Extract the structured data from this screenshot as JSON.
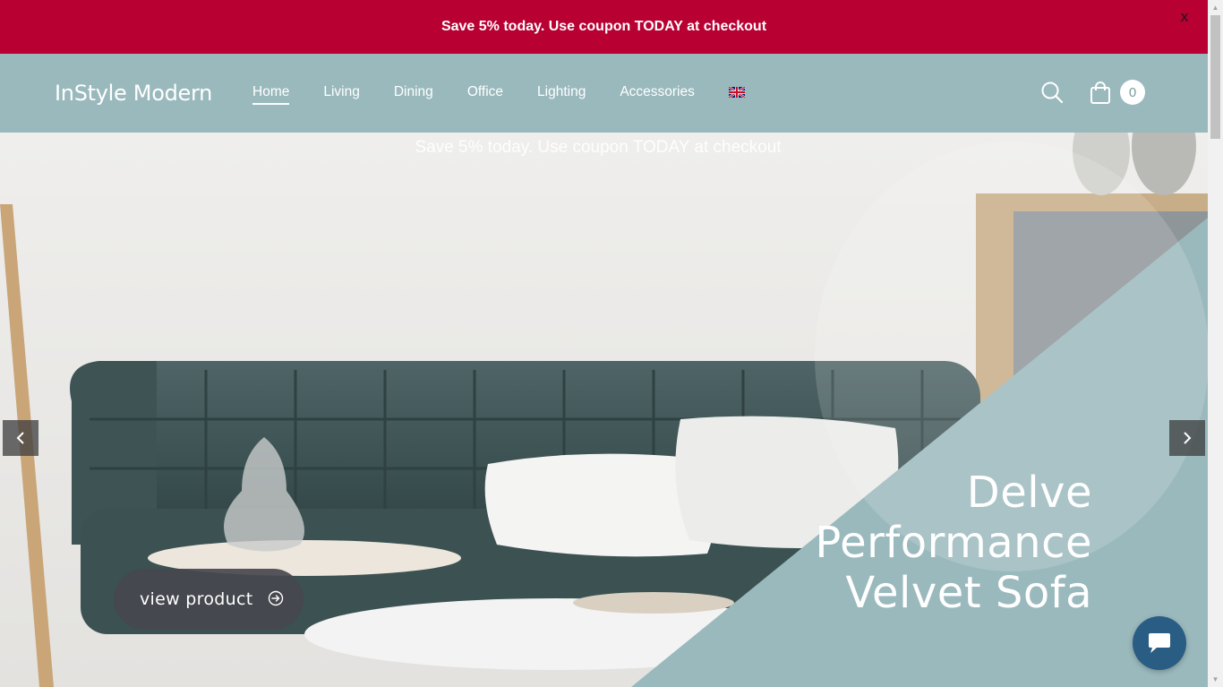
{
  "promo": {
    "text": "Save 5% today. Use coupon TODAY at checkout",
    "close_label": "X"
  },
  "header": {
    "logo": "InStyle Modern",
    "nav": [
      {
        "label": "Home",
        "active": true
      },
      {
        "label": "Living"
      },
      {
        "label": "Dining"
      },
      {
        "label": "Office"
      },
      {
        "label": "Lighting"
      },
      {
        "label": "Accessories"
      }
    ],
    "language_icon": "uk-flag-icon",
    "search_icon": "search-icon",
    "cart_icon": "shopping-bag-icon",
    "cart_count": "0"
  },
  "hero": {
    "promo_text": "Save 5% today. Use coupon TODAY at checkout",
    "title_lines": [
      "Delve",
      "Performance",
      "Velvet Sofa"
    ],
    "button_label": "view product",
    "prev_icon": "chevron-left-icon",
    "next_icon": "chevron-right-icon",
    "chat_icon": "chat-bubble-icon"
  },
  "colors": {
    "promo_bg": "#b80032",
    "header_bg": "#9ab9bd",
    "accent_teal": "#9ab9bd",
    "chat_bg": "#2a5d84"
  }
}
